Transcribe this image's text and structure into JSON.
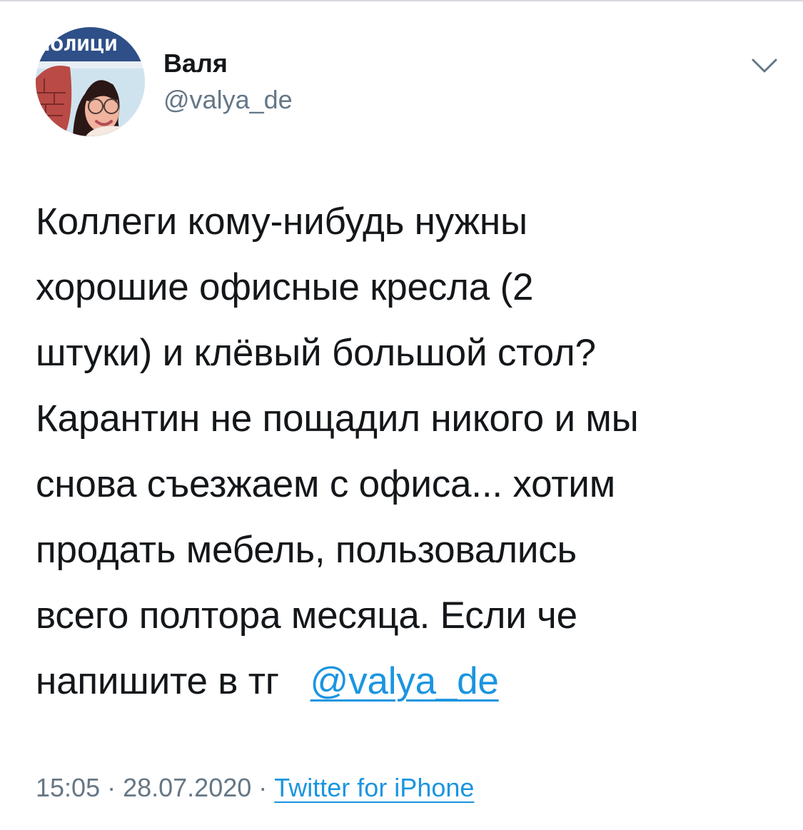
{
  "author": {
    "display_name": "Валя",
    "handle": "@valya_de",
    "avatar_sign_text": "ПОЛИЦИ"
  },
  "tweet": {
    "lines": [
      "Коллеги кому-нибудь нужны",
      "хорошие офисные кресла (2",
      "штуки) и клёвый большой стол?",
      "Карантин не пощадил никого и мы",
      "снова съезжаем с офиса... хотим",
      "продать мебель, пользовались",
      "всего полтора месяца. Если че"
    ],
    "last_line_prefix": "напишите в тг",
    "mention": "@valya_de"
  },
  "meta": {
    "time": "15:05",
    "date": "28.07.2020",
    "separator": "·",
    "source": "Twitter for iPhone"
  },
  "icons": {
    "menu": "chevron-down-icon"
  },
  "colors": {
    "text": "#14171a",
    "secondary": "#657786",
    "link": "#1b95e0",
    "divider": "#d6d9dc"
  }
}
